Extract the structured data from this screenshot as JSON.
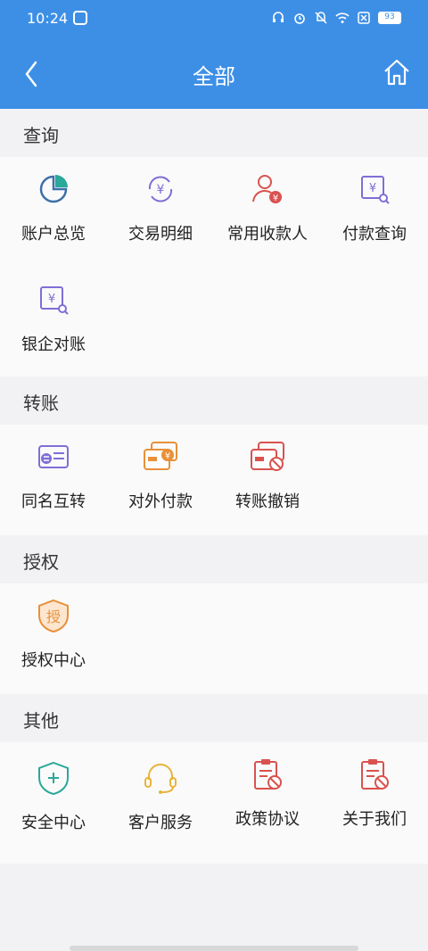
{
  "status": {
    "time": "10:24",
    "battery": "93"
  },
  "nav": {
    "title": "全部"
  },
  "sections": [
    {
      "title": "查询",
      "items": [
        "账户总览",
        "交易明细",
        "常用收款人",
        "付款查询",
        "银企对账"
      ]
    },
    {
      "title": "转账",
      "items": [
        "同名互转",
        "对外付款",
        "转账撤销"
      ]
    },
    {
      "title": "授权",
      "items": [
        "授权中心"
      ],
      "icon_char": "授"
    },
    {
      "title": "其他",
      "items": [
        "安全中心",
        "客户服务",
        "政策协议",
        "关于我们"
      ]
    }
  ],
  "colors": {
    "brand": "#3d8fe6",
    "purple": "#7e6fd6",
    "orange": "#e8903a",
    "red": "#d9524f",
    "teal": "#2aa89a",
    "gold": "#e8b43a"
  }
}
